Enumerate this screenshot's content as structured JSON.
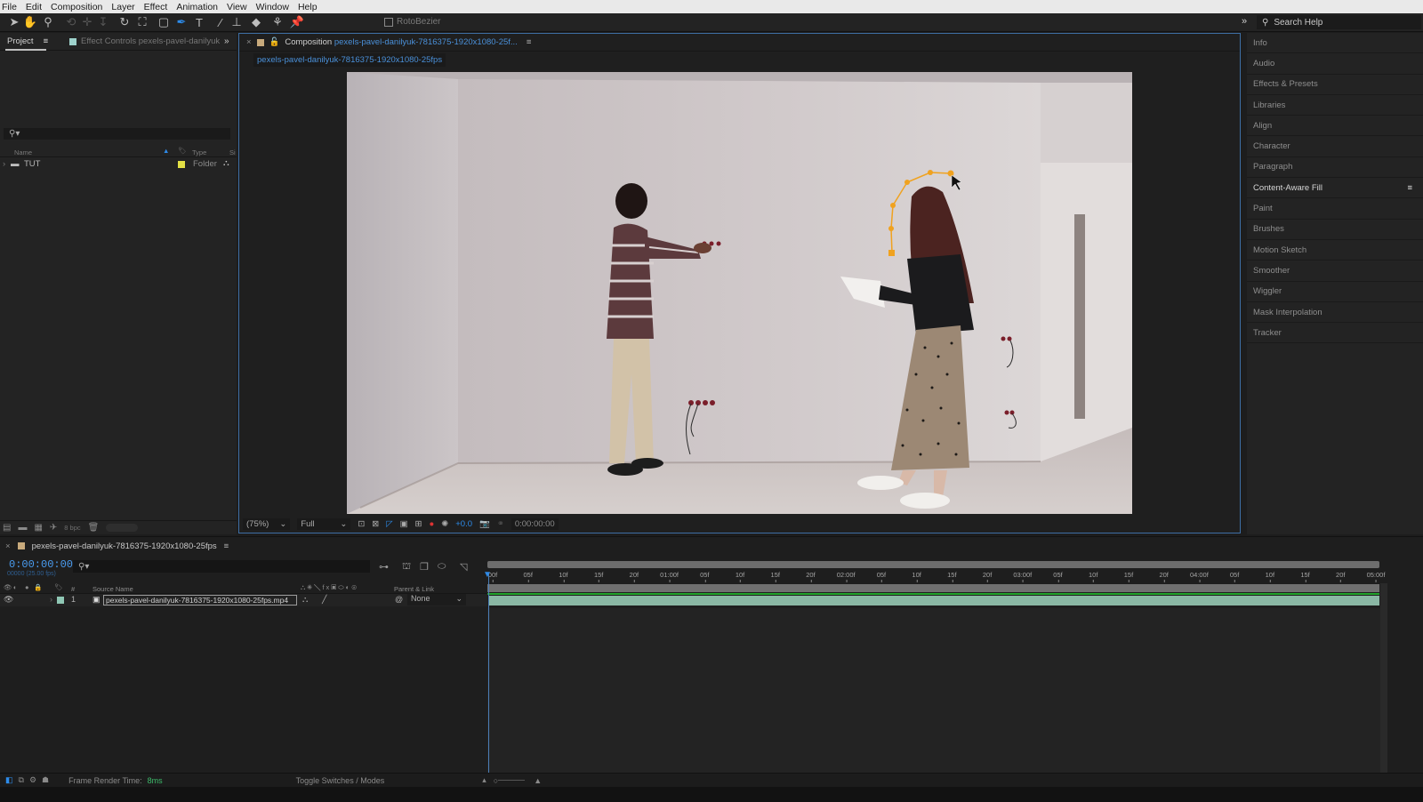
{
  "menu": [
    "File",
    "Edit",
    "Composition",
    "Layer",
    "Effect",
    "Animation",
    "View",
    "Window",
    "Help"
  ],
  "toolbar": {
    "tools": [
      {
        "name": "selection-tool",
        "glyph": "➤",
        "state": "normal"
      },
      {
        "name": "hand-tool",
        "glyph": "✋",
        "state": "normal"
      },
      {
        "name": "zoom-tool",
        "glyph": "⚲",
        "state": "normal"
      },
      {
        "name": "orbit-camera-tool",
        "glyph": "⟲",
        "state": "dim"
      },
      {
        "name": "pan-camera-tool",
        "glyph": "✛",
        "state": "dim"
      },
      {
        "name": "dolly-camera-tool",
        "glyph": "↧",
        "state": "dim"
      },
      {
        "name": "rotation-tool",
        "glyph": "↻",
        "state": "normal"
      },
      {
        "name": "anchor-point-tool",
        "glyph": "⛶",
        "state": "normal"
      },
      {
        "name": "rectangle-tool",
        "glyph": "▢",
        "state": "normal"
      },
      {
        "name": "pen-tool",
        "glyph": "✒",
        "state": "active"
      },
      {
        "name": "type-tool",
        "glyph": "T",
        "state": "normal"
      },
      {
        "name": "brush-tool",
        "glyph": "⁄",
        "state": "normal"
      },
      {
        "name": "clone-stamp-tool",
        "glyph": "⊥",
        "state": "normal"
      },
      {
        "name": "eraser-tool",
        "glyph": "◆",
        "state": "normal"
      },
      {
        "name": "roto-brush-tool",
        "glyph": "⚘",
        "state": "normal"
      },
      {
        "name": "puppet-pin-tool",
        "glyph": "📌",
        "state": "normal"
      }
    ],
    "rotobezier_label": "RotoBezier",
    "rotobezier_checked": false,
    "search_help_placeholder": "Search Help"
  },
  "project_panel": {
    "tabs": [
      {
        "label": "Project",
        "active": true
      },
      {
        "label": "Effect Controls pexels-pavel-danilyuk",
        "active": false
      }
    ],
    "columns": {
      "name": "Name",
      "type": "Type",
      "size": "Si"
    },
    "items": [
      {
        "name": "TUT",
        "type": "Folder",
        "label_color": "#e3e045"
      }
    ],
    "bpc_label": "8 bpc"
  },
  "composition_panel": {
    "tab_prefix": "Composition",
    "tab_name": "pexels-pavel-danilyuk-7816375-1920x1080-25f...",
    "breadcrumb": "pexels-pavel-danilyuk-7816375-1920x1080-25fps",
    "label_color": "#c8aa7c",
    "footer": {
      "magnification": "(75%)",
      "resolution": "Full",
      "exposure": "+0.0",
      "timecode": "0:00:00:00"
    }
  },
  "right_panel": {
    "items": [
      {
        "label": "Info",
        "active": false
      },
      {
        "label": "Audio",
        "active": false
      },
      {
        "label": "Effects & Presets",
        "active": false
      },
      {
        "label": "Libraries",
        "active": false
      },
      {
        "label": "Align",
        "active": false
      },
      {
        "label": "Character",
        "active": false
      },
      {
        "label": "Paragraph",
        "active": false
      },
      {
        "label": "Content-Aware Fill",
        "active": true
      },
      {
        "label": "Paint",
        "active": false
      },
      {
        "label": "Brushes",
        "active": false
      },
      {
        "label": "Motion Sketch",
        "active": false
      },
      {
        "label": "Smoother",
        "active": false
      },
      {
        "label": "Wiggler",
        "active": false
      },
      {
        "label": "Mask Interpolation",
        "active": false
      },
      {
        "label": "Tracker",
        "active": false
      }
    ]
  },
  "timeline": {
    "tab_label": "pexels-pavel-danilyuk-7816375-1920x1080-25fps",
    "current_time": "0:00:00:00",
    "frame_info": "00000 (25.00 fps)",
    "columns": {
      "source_name": "Source Name",
      "number": "#",
      "parent_link": "Parent & Link"
    },
    "layers": [
      {
        "index": "1",
        "source_name": "pexels-pavel-danilyuk-7816375-1920x1080-25fps.mp4",
        "parent": "None",
        "label_color": "#8fc7b4"
      }
    ],
    "ruler_ticks": [
      "00f",
      "05f",
      "10f",
      "15f",
      "20f",
      "01:00f",
      "05f",
      "10f",
      "15f",
      "20f",
      "02:00f",
      "05f",
      "10f",
      "15f",
      "20f",
      "03:00f",
      "05f",
      "10f",
      "15f",
      "20f",
      "04:00f",
      "05f",
      "10f",
      "15f",
      "20f",
      "05:00f"
    ],
    "playhead_fraction": 0.0
  },
  "statusbar": {
    "frame_render_label": "Frame Render Time:",
    "frame_render_value": "8ms",
    "toggle_label": "Toggle Switches / Modes"
  },
  "mask_points": 6
}
